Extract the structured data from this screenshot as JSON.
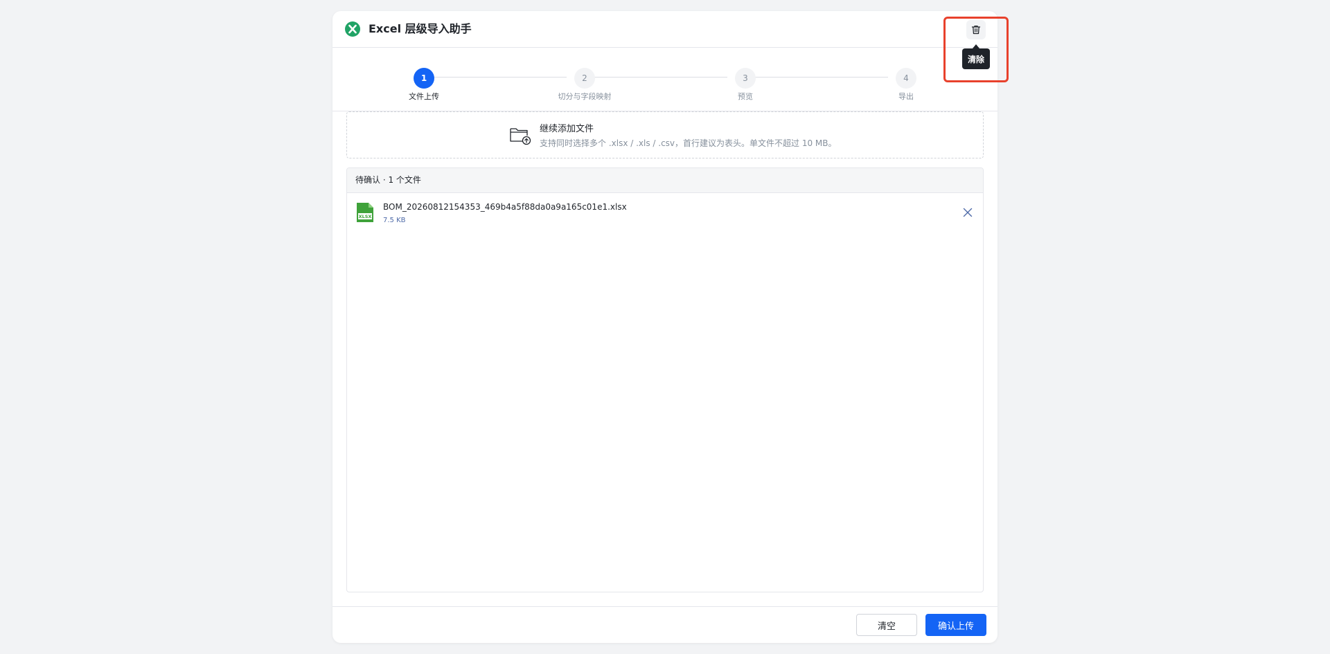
{
  "app": {
    "title": "Excel 层级导入助手",
    "icon": "excel-logo-icon",
    "accent_color": "#1464f5",
    "logo_color": "#21a366"
  },
  "header": {
    "trash_icon": "trash-icon",
    "tooltip": "清除"
  },
  "steps": [
    {
      "number": "1",
      "label": "文件上传",
      "active": true
    },
    {
      "number": "2",
      "label": "切分与字段映射",
      "active": false
    },
    {
      "number": "3",
      "label": "预览",
      "active": false
    },
    {
      "number": "4",
      "label": "导出",
      "active": false
    }
  ],
  "dropzone": {
    "icon": "folder-upload-icon",
    "title": "继续添加文件",
    "hint": "支持同时选择多个 .xlsx / .xls / .csv，首行建议为表头。单文件不超过 10 MB。"
  },
  "filelist": {
    "header": "待确认 · 1 个文件",
    "files": [
      {
        "name": "BOM_20260812154353_469b4a5f88da0a9a165c01e1.xlsx",
        "size": "7.5 KB",
        "icon": "xlsx-file-icon",
        "remove_icon": "close-icon"
      }
    ]
  },
  "footer": {
    "clear_label": "清空",
    "confirm_label": "确认上传"
  }
}
